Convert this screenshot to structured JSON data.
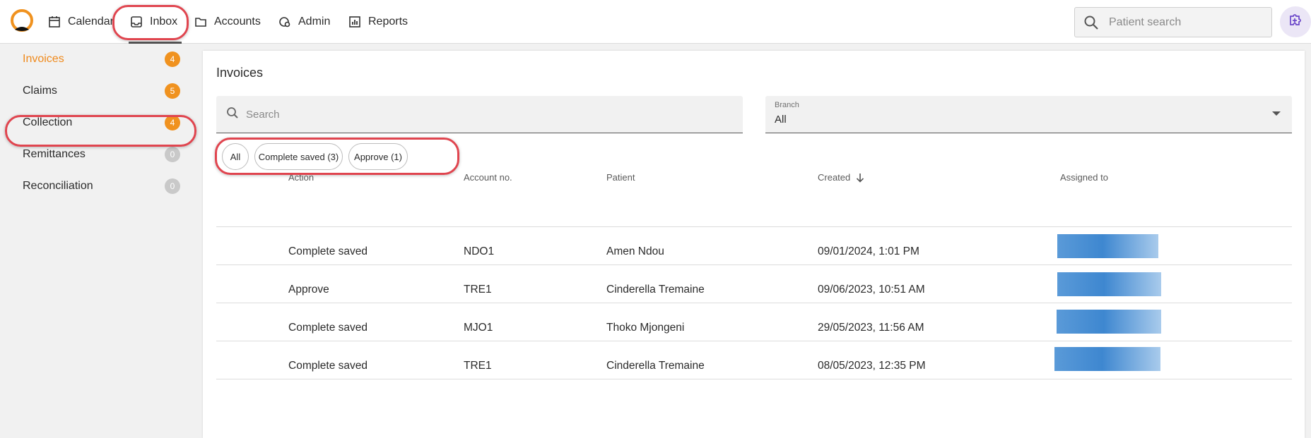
{
  "topnav": {
    "items": [
      {
        "label": "Calendar",
        "icon": "calendar-icon"
      },
      {
        "label": "Inbox",
        "icon": "inbox-icon",
        "active": true
      },
      {
        "label": "Accounts",
        "icon": "folder-icon"
      },
      {
        "label": "Admin",
        "icon": "admin-icon"
      },
      {
        "label": "Reports",
        "icon": "reports-icon"
      }
    ],
    "search_placeholder": "Patient search"
  },
  "sidebar": {
    "items": [
      {
        "label": "Invoices",
        "count": "4",
        "active": true,
        "badge_color": "#f0921f"
      },
      {
        "label": "Claims",
        "count": "5",
        "badge_color": "#f0921f"
      },
      {
        "label": "Collection",
        "count": "4",
        "badge_color": "#f0921f"
      },
      {
        "label": "Remittances",
        "count": "0",
        "badge_color": "#c9c9c9"
      },
      {
        "label": "Reconciliation",
        "count": "0",
        "badge_color": "#c9c9c9"
      }
    ]
  },
  "main": {
    "title": "Invoices",
    "search_placeholder": "Search",
    "branch": {
      "label": "Branch",
      "value": "All"
    },
    "filters": [
      "All",
      "Complete saved (3)",
      "Approve (1)"
    ],
    "columns": [
      "Action",
      "Account no.",
      "Patient",
      "Created",
      "Assigned to"
    ],
    "rows": [
      {
        "action": "Complete saved",
        "account": "NDO1",
        "patient": "Amen Ndou",
        "created": "09/01/2024, 1:01 PM"
      },
      {
        "action": "Approve",
        "account": "TRE1",
        "patient": "Cinderella Tremaine",
        "created": "09/06/2023, 10:51 AM"
      },
      {
        "action": "Complete saved",
        "account": "MJO1",
        "patient": "Thoko Mjongeni",
        "created": "29/05/2023, 11:56 AM"
      },
      {
        "action": "Complete saved",
        "account": "TRE1",
        "patient": "Cinderella Tremaine",
        "created": "08/05/2023, 12:35 PM"
      }
    ]
  },
  "colors": {
    "accent": "#f08a1c",
    "highlight": "#e0454f",
    "assignee_blur": "#3e87d0"
  }
}
